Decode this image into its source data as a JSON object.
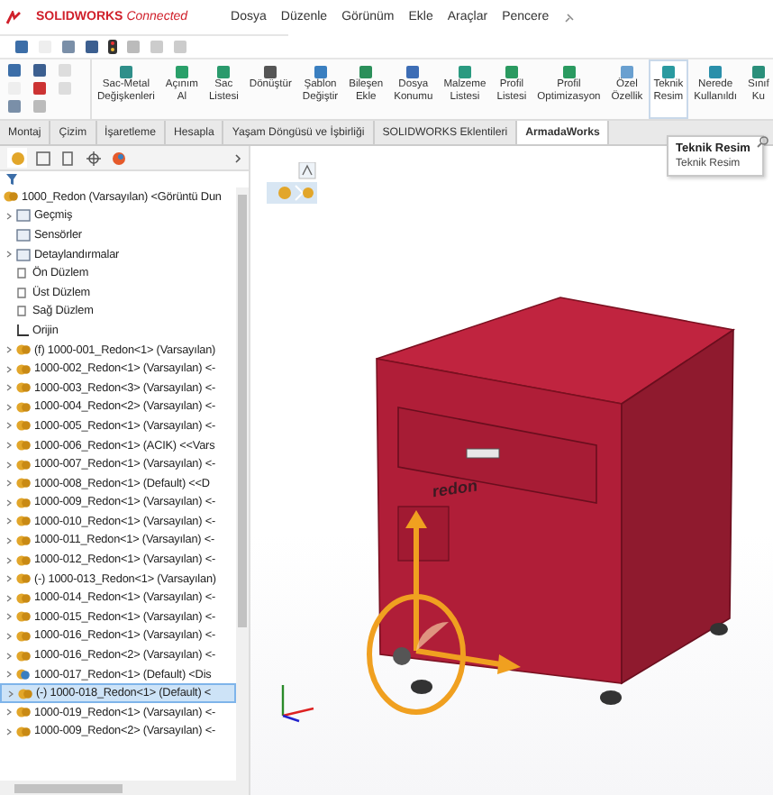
{
  "title_bar": {
    "brand": "SOLIDWORKS",
    "suffix": "Connected",
    "menu": [
      "Dosya",
      "Düzenle",
      "Görünüm",
      "Ekle",
      "Araçlar",
      "Pencere"
    ]
  },
  "ribbon": {
    "tools": [
      {
        "lines": [
          "Sac-Metal",
          "Değişkenleri"
        ],
        "selected": false
      },
      {
        "lines": [
          "Açınım",
          "Al"
        ],
        "selected": false
      },
      {
        "lines": [
          "Sac",
          "Listesi"
        ],
        "selected": false
      },
      {
        "lines": [
          "Dönüştür"
        ],
        "selected": false
      },
      {
        "lines": [
          "Şablon",
          "Değiştir"
        ],
        "selected": false
      },
      {
        "lines": [
          "Bileşen",
          "Ekle"
        ],
        "selected": false
      },
      {
        "lines": [
          "Dosya",
          "Konumu"
        ],
        "selected": false
      },
      {
        "lines": [
          "Malzeme",
          "Listesi"
        ],
        "selected": false
      },
      {
        "lines": [
          "Profil",
          "Listesi"
        ],
        "selected": false
      },
      {
        "lines": [
          "Profil",
          "Optimizasyon"
        ],
        "selected": false
      },
      {
        "lines": [
          "Özel",
          "Özellik"
        ],
        "selected": false
      },
      {
        "lines": [
          "Teknik",
          "Resim"
        ],
        "selected": true
      },
      {
        "lines": [
          "Nerede",
          "Kullanıldı"
        ],
        "selected": false
      },
      {
        "lines": [
          "Sınıf",
          "Ku"
        ],
        "selected": false
      }
    ]
  },
  "tabs": [
    {
      "label": "Montaj",
      "selected": false
    },
    {
      "label": "Çizim",
      "selected": false
    },
    {
      "label": "İşaretleme",
      "selected": false
    },
    {
      "label": "Hesapla",
      "selected": false
    },
    {
      "label": "Yaşam Döngüsü ve İşbirliği",
      "selected": false
    },
    {
      "label": "SOLIDWORKS Eklentileri",
      "selected": false
    },
    {
      "label": "ArmadaWorks",
      "selected": true
    }
  ],
  "tooltip": {
    "title": "Teknik Resim",
    "text": "Teknik Resim"
  },
  "tree": {
    "root": "1000_Redon (Varsayılan) <Görüntü Dun",
    "items": [
      {
        "label": "Geçmiş",
        "kind": "folder",
        "expandable": true,
        "selected": false
      },
      {
        "label": "Sensörler",
        "kind": "folder",
        "expandable": false,
        "selected": false
      },
      {
        "label": "Detaylandırmalar",
        "kind": "folder",
        "expandable": true,
        "selected": false
      },
      {
        "label": "Ön Düzlem",
        "kind": "plane",
        "expandable": false,
        "selected": false
      },
      {
        "label": "Üst Düzlem",
        "kind": "plane",
        "expandable": false,
        "selected": false
      },
      {
        "label": "Sağ Düzlem",
        "kind": "plane",
        "expandable": false,
        "selected": false
      },
      {
        "label": "Orijin",
        "kind": "origin",
        "expandable": false,
        "selected": false
      },
      {
        "label": "(f) 1000-001_Redon<1> (Varsayılan)",
        "kind": "part",
        "expandable": true,
        "selected": false
      },
      {
        "label": "1000-002_Redon<1> (Varsayılan) <-",
        "kind": "part",
        "expandable": true,
        "selected": false
      },
      {
        "label": "1000-003_Redon<3> (Varsayılan) <-",
        "kind": "part",
        "expandable": true,
        "selected": false
      },
      {
        "label": "1000-004_Redon<2> (Varsayılan) <-",
        "kind": "part",
        "expandable": true,
        "selected": false
      },
      {
        "label": "1000-005_Redon<1> (Varsayılan) <-",
        "kind": "part",
        "expandable": true,
        "selected": false
      },
      {
        "label": "1000-006_Redon<1> (ACIK) <<Vars",
        "kind": "part",
        "expandable": true,
        "selected": false
      },
      {
        "label": "1000-007_Redon<1> (Varsayılan) <-",
        "kind": "part",
        "expandable": true,
        "selected": false
      },
      {
        "label": "1000-008_Redon<1> (Default) <<D",
        "kind": "part",
        "expandable": true,
        "selected": false
      },
      {
        "label": "1000-009_Redon<1> (Varsayılan) <-",
        "kind": "part",
        "expandable": true,
        "selected": false
      },
      {
        "label": "1000-010_Redon<1> (Varsayılan) <-",
        "kind": "part",
        "expandable": true,
        "selected": false
      },
      {
        "label": "1000-011_Redon<1> (Varsayılan) <-",
        "kind": "part",
        "expandable": true,
        "selected": false
      },
      {
        "label": "1000-012_Redon<1> (Varsayılan) <-",
        "kind": "part",
        "expandable": true,
        "selected": false
      },
      {
        "label": "(-) 1000-013_Redon<1> (Varsayılan)",
        "kind": "part",
        "expandable": true,
        "selected": false
      },
      {
        "label": "1000-014_Redon<1> (Varsayılan) <-",
        "kind": "part",
        "expandable": true,
        "selected": false
      },
      {
        "label": "1000-015_Redon<1> (Varsayılan) <-",
        "kind": "part",
        "expandable": true,
        "selected": false
      },
      {
        "label": "1000-016_Redon<1> (Varsayılan) <-",
        "kind": "part",
        "expandable": true,
        "selected": false
      },
      {
        "label": "1000-016_Redon<2> (Varsayılan) <-",
        "kind": "part",
        "expandable": true,
        "selected": false
      },
      {
        "label": "1000-017_Redon<1> (Default) <Dis",
        "kind": "assembly",
        "expandable": true,
        "selected": false
      },
      {
        "label": "(-) 1000-018_Redon<1> (Default) <",
        "kind": "part",
        "expandable": true,
        "selected": true
      },
      {
        "label": "1000-019_Redon<1> (Varsayılan) <-",
        "kind": "part",
        "expandable": true,
        "selected": false
      },
      {
        "label": "1000-009_Redon<2> (Varsayılan) <-",
        "kind": "part",
        "expandable": true,
        "selected": false
      }
    ]
  },
  "viewport": {
    "logo_text": "redon"
  }
}
